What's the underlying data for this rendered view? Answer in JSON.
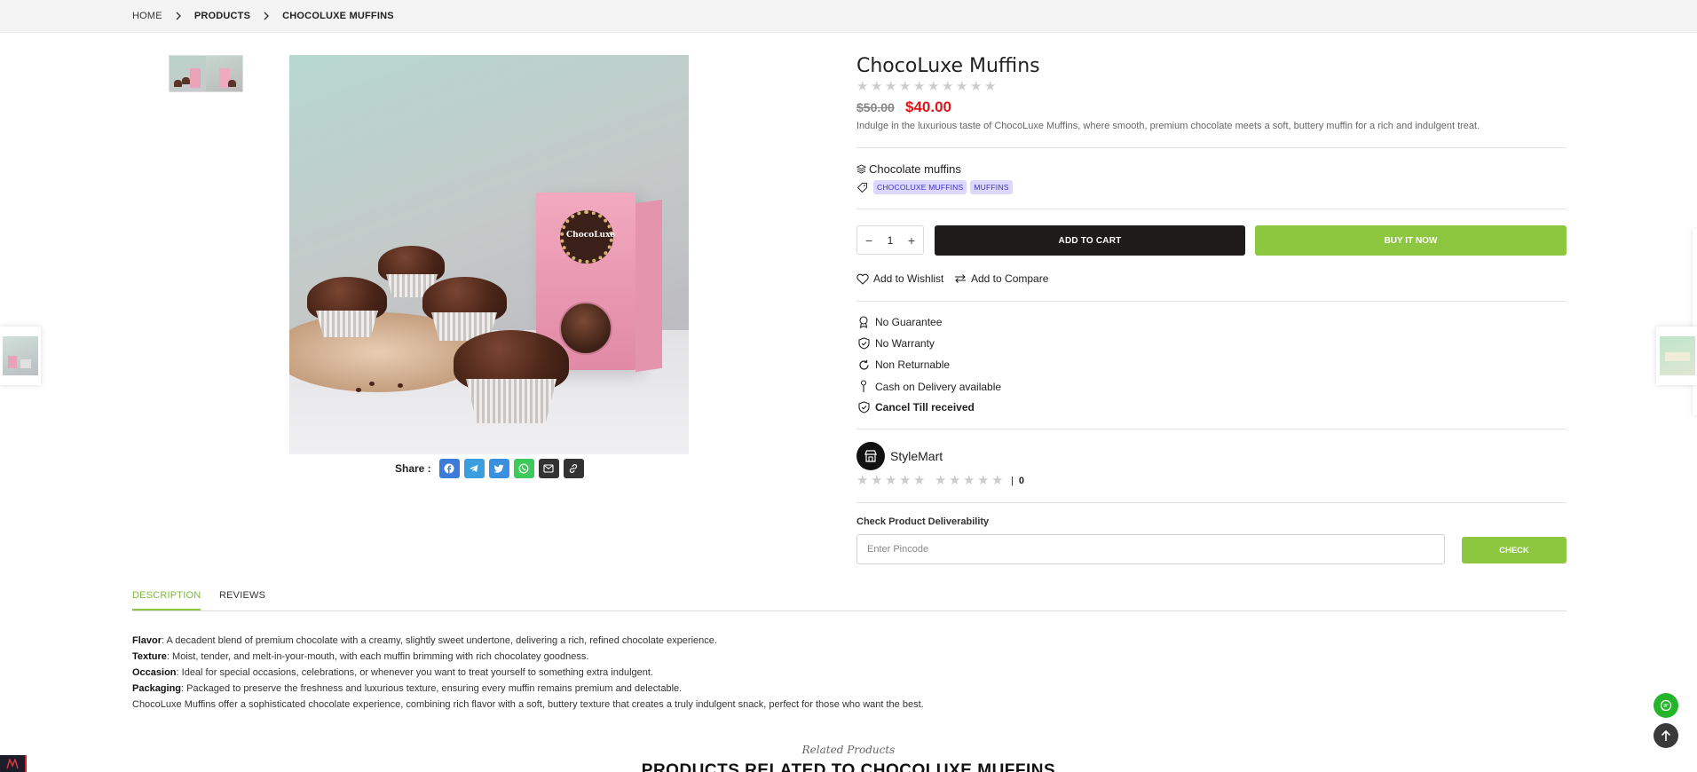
{
  "breadcrumb": {
    "home": "HOME",
    "products": "PRODUCTS",
    "current": "CHOCOLUXE MUFFINS"
  },
  "gallery": {
    "box_brand": "ChocoLuxe"
  },
  "share": {
    "label": "Share :",
    "buttons": [
      {
        "name": "facebook-icon",
        "color": "#3b7bd9"
      },
      {
        "name": "telegram-icon",
        "color": "#3a9ee0"
      },
      {
        "name": "twitter-icon",
        "color": "#3b8fdf"
      },
      {
        "name": "whatsapp-icon",
        "color": "#3ec95c"
      },
      {
        "name": "mail-icon",
        "color": "#333333"
      },
      {
        "name": "link-icon",
        "color": "#333333"
      }
    ]
  },
  "product": {
    "title": "ChocoLuxe Muffins",
    "rating": 0,
    "rating_max": 10,
    "old_price": "$50.00",
    "price": "$40.00",
    "description": "Indulge in the luxurious taste of ChocoLuxe Muffins, where smooth, premium chocolate meets a soft, buttery muffin for a rich and indulgent treat.",
    "category": "Chocolate muffins",
    "tags": [
      "CHOCOLUXE MUFFINS",
      "MUFFINS"
    ],
    "quantity": "1"
  },
  "actions": {
    "add_to_cart": "ADD TO CART",
    "buy_now": "BUY IT NOW",
    "wishlist": "Add to Wishlist",
    "compare": "Add to Compare"
  },
  "features": [
    {
      "icon": "award-icon",
      "label": "No Guarantee",
      "bold": false
    },
    {
      "icon": "shield-check-icon",
      "label": "No Warranty",
      "bold": false
    },
    {
      "icon": "refresh-icon",
      "label": "Non Returnable",
      "bold": false
    },
    {
      "icon": "pin-icon",
      "label": "Cash on Delivery available",
      "bold": false
    },
    {
      "icon": "shield-check-icon",
      "label": "Cancel Till received",
      "bold": true
    }
  ],
  "seller": {
    "name": "StyleMart",
    "review_separator": "|",
    "review_count": "0"
  },
  "deliverability": {
    "label": "Check Product Deliverability",
    "placeholder": "Enter Pincode",
    "button": "CHECK"
  },
  "tabs": {
    "description": "DESCRIPTION",
    "reviews": "REVIEWS"
  },
  "details": {
    "flavor_label": "Flavor",
    "flavor_text": ": A decadent blend of premium chocolate with a creamy, slightly sweet undertone, delivering a rich, refined chocolate experience.",
    "texture_label": "Texture",
    "texture_text": ": Moist, tender, and melt-in-your-mouth, with each muffin brimming with rich chocolatey goodness.",
    "occasion_label": "Occasion",
    "occasion_text": ": Ideal for special occasions, celebrations, or whenever you want to treat yourself to something extra indulgent.",
    "packaging_label": "Packaging",
    "packaging_text": ": Packaged to preserve the freshness and luxurious texture, ensuring every muffin remains premium and delectable.",
    "summary": "ChocoLuxe Muffins offer a sophisticated chocolate experience, combining rich flavor with a soft, buttery texture that creates a truly indulgent snack, perfect for those who want the best."
  },
  "related": {
    "subtitle": "Related Products",
    "title": "PRODUCTS RELATED TO CHOCOLUXE MUFFINS"
  },
  "colors": {
    "accent_green": "#8dc63f",
    "price_red": "#e0161b",
    "tag_bg": "#dcd8fb",
    "tag_text": "#3b31c6",
    "dark_button": "#1f1b1b"
  }
}
